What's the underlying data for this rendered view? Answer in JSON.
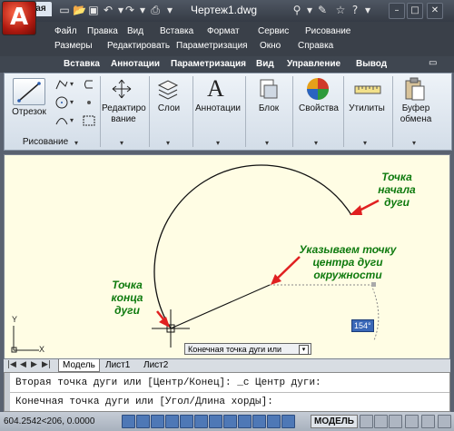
{
  "app_button": {
    "glyph": "A"
  },
  "title": "Чертеж1.dwg",
  "menu": {
    "row1": [
      "Файл",
      "Правка",
      "Вид",
      "Вставка",
      "Формат",
      "Сервис",
      "Рисование"
    ],
    "row2": [
      "Размеры",
      "Редактировать",
      "Параметризация",
      "Окно",
      "Справка"
    ]
  },
  "tabs": [
    "Главная",
    "Вставка",
    "Аннотации",
    "Параметризация",
    "Вид",
    "Управление",
    "Вывод"
  ],
  "ribbon": {
    "otrezok": "Отрезок",
    "risovanie": "Рисование",
    "redakt1": "Редактиро",
    "redakt2": "вание",
    "sloi": "Слои",
    "annot": "Аннотации",
    "blok": "Блок",
    "svoystva": "Свойства",
    "utility": "Утилиты",
    "bufer1": "Буфер",
    "bufer2": "обмена",
    "annot_icon": "A"
  },
  "canvas": {
    "label_start": [
      "Точка",
      "начала",
      "дуги"
    ],
    "label_center": [
      "Указываем точку",
      "центра дуги",
      "окружности"
    ],
    "label_end": [
      "Точка",
      "конца",
      "дуги"
    ],
    "tooltip": "Конечная точка дуги или",
    "dim_value": "154°",
    "axis_y": "Y",
    "axis_x": "X"
  },
  "model_tabs": [
    "Модель",
    "Лист1",
    "Лист2"
  ],
  "command": {
    "line1": "Вторая точка дуги или [Центр/Конец]: _c Центр дуги:",
    "line2": "Конечная точка дуги или [Угол/Длина хорды]:"
  },
  "status": {
    "coords": "604.2542<206, 0.0000",
    "model": "МОДЕЛЬ"
  },
  "colors": {
    "arrow_red": "#e02020",
    "green_text": "#0e7a0e",
    "canvas_bg": "#fffde4"
  }
}
